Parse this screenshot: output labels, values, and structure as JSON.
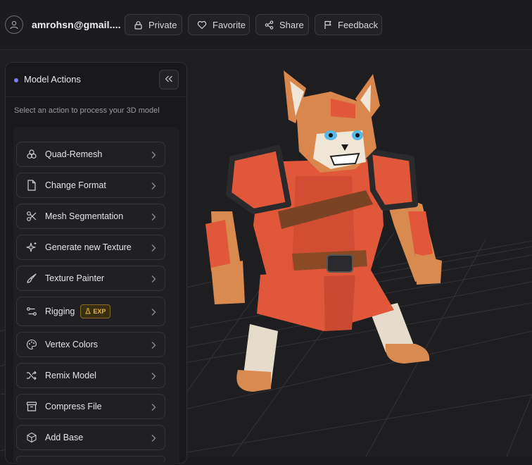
{
  "header": {
    "email": "amrohsn@gmail....",
    "buttons": [
      {
        "label": "Private",
        "icon": "lock-icon"
      },
      {
        "label": "Favorite",
        "icon": "heart-icon"
      },
      {
        "label": "Share",
        "icon": "share-icon"
      },
      {
        "label": "Feedback",
        "icon": "flag-icon"
      }
    ]
  },
  "panel": {
    "title": "Model Actions",
    "subtitle": "Select an action to process your 3D model",
    "accent": "#7b7cf0",
    "actions": [
      {
        "label": "Quad-Remesh",
        "icon": "remesh-icon"
      },
      {
        "label": "Change Format",
        "icon": "file-icon"
      },
      {
        "label": "Mesh Segmentation",
        "icon": "scissors-icon"
      },
      {
        "label": "Generate new Texture",
        "icon": "sparkles-icon"
      },
      {
        "label": "Texture Painter",
        "icon": "brush-icon"
      },
      {
        "label": "Rigging",
        "icon": "rig-icon",
        "badge": "EXP"
      },
      {
        "label": "Vertex Colors",
        "icon": "palette-icon"
      },
      {
        "label": "Remix Model",
        "icon": "shuffle-icon"
      },
      {
        "label": "Compress File",
        "icon": "archive-icon"
      },
      {
        "label": "Add Base",
        "icon": "cube-icon"
      }
    ]
  },
  "colors": {
    "background": "#1e1e21",
    "badge": "#e8b83a",
    "armor": "#e05a3c"
  }
}
